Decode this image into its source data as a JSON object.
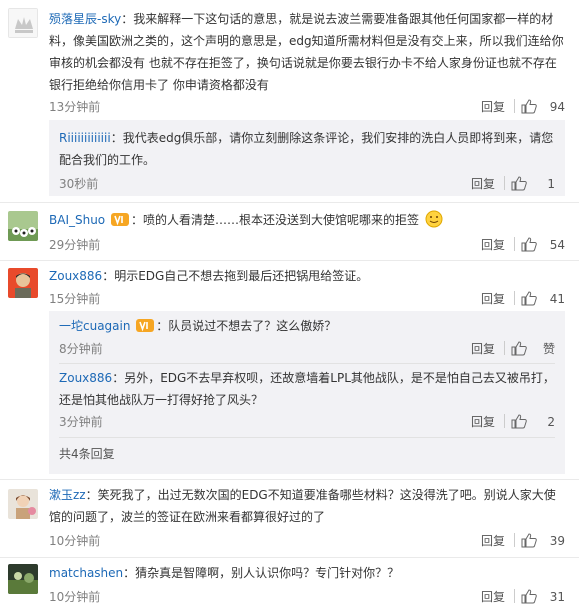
{
  "comments": [
    {
      "user": "殒落星辰-sky",
      "text": "：我来解释一下这句话的意思，就是说去波兰需要准备跟其他任何国家都一样的材料，像美国欧洲之类的，这个声明的意思是，edg知道所需材料但是没有交上来，所以我们连给你审核的机会都没有 也就不存在拒签了，换句话说就是你要去银行办卡不给人家身份证也就不存在银行拒绝给你信用卡了 你申请资格都没有",
      "time": "13分钟前",
      "reply": "回复",
      "likes": "94",
      "subs": [
        {
          "user": "Riiiiiiiiiiiii",
          "text": "：我代表edg俱乐部，请你立刻删除这条评论，我们安排的洗白人员即将到来，请您配合我们的工作。",
          "time": "30秒前",
          "reply": "回复",
          "likes": "1"
        }
      ]
    },
    {
      "user": "BAI_Shuo",
      "text": "：喷的人看清楚……根本还没送到大使馆呢哪来的拒签",
      "time": "29分钟前",
      "reply": "回复",
      "likes": "54"
    },
    {
      "user": "Zoux886",
      "text": "：明示EDG自己不想去拖到最后还把锅甩给签证。",
      "time": "15分钟前",
      "reply": "回复",
      "likes": "41",
      "subs": [
        {
          "user": "一坨cuagain",
          "text": "：队员说过不想去了？这么傲娇？",
          "time": "8分钟前",
          "reply": "回复",
          "likes": "赞"
        },
        {
          "user": "Zoux886",
          "text": "：另外，EDG不去早弃权呗，还故意墙着LPL其他战队，是不是怕自己去又被吊打，还是怕其他战队万一打得好抢了风头？",
          "time": "3分钟前",
          "reply": "回复",
          "likes": "2"
        }
      ],
      "more": "共4条回复"
    },
    {
      "user": "漱玉zz",
      "text": "：笑死我了，出过无数次国的EDG不知道要准备哪些材料？这没得洗了吧。别说人家大使馆的问题了，波兰的签证在欧洲来看都算很好过的了",
      "time": "10分钟前",
      "reply": "回复",
      "likes": "39"
    },
    {
      "user": "matchashen",
      "text": "：猜杂真是智障啊，别人认识你吗？专门针对你？？",
      "time": "10分钟前",
      "reply": "回复",
      "likes": "31"
    }
  ],
  "colors": {
    "username_orange": "#eb7350",
    "meta_gray": "#808080",
    "sub_bg": "#f2f2f5"
  }
}
